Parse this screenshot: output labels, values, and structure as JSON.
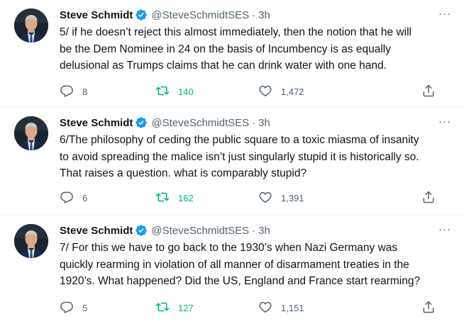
{
  "tweets": [
    {
      "name": "Steve Schmidt",
      "handle": "@SteveSchmidtSES",
      "dot": "·",
      "time": "3h",
      "more": "···",
      "text": "5/ if he doesn’t reject this almost immediately, then the notion that he will\nbe the Dem Nominee in 24 on the basis of Incumbency is as equally\ndelusional as Trumps claims that he can drink water with one hand.",
      "replies": "8",
      "retweets": "140",
      "likes": "1,472"
    },
    {
      "name": "Steve Schmidt",
      "handle": "@SteveSchmidtSES",
      "dot": "·",
      "time": "3h",
      "more": "···",
      "text": "6/The philosophy of ceding the public square to a toxic miasma of insanity\nto avoid spreading the malice isn’t just singularly stupid it is historically so.\nThat raises a question. what is comparably stupid?",
      "replies": "6",
      "retweets": "162",
      "likes": "1,391"
    },
    {
      "name": "Steve Schmidt",
      "handle": "@SteveSchmidtSES",
      "dot": "·",
      "time": "3h",
      "more": "···",
      "text": "7/ For this we have to go back to the 1930’s when Nazi Germany was\nquickly rearming in violation of all manner of disarmament treaties in the\n1920’s. What happened? Did the US, England and France start rearming?",
      "replies": "5",
      "retweets": "127",
      "likes": "1,151"
    }
  ],
  "colors": {
    "verified": "#1d9bf0",
    "retweet_active": "#00ba7c",
    "secondary": "#536471"
  },
  "icons": [
    "verified-badge-icon",
    "reply-icon",
    "retweet-icon",
    "like-icon",
    "share-icon",
    "more-icon"
  ]
}
